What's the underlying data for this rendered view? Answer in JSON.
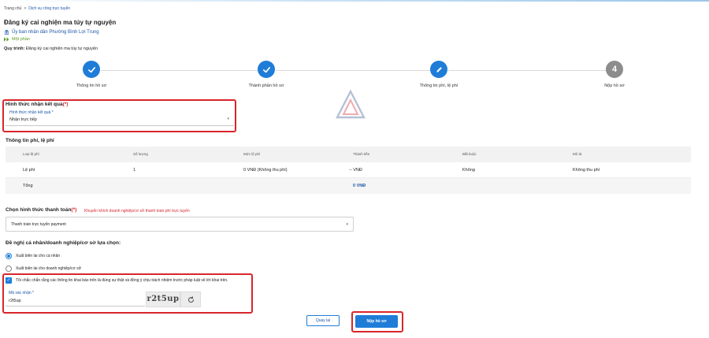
{
  "breadcrumb": {
    "home": "Trang chủ",
    "separator": ">",
    "current": "Dịch vụ công trực tuyến"
  },
  "procedure": {
    "title": "Đăng ký cai nghiện ma túy tự nguyện",
    "agency": "Ủy ban nhân dân Phường Bình Lợi Trung",
    "level": "Một phần",
    "process_label": "Quy trình:",
    "process_value": "Đăng ký cai nghiện ma túy tự nguyện"
  },
  "steps": [
    {
      "label": "Thông tin hồ sơ",
      "state": "done",
      "icon": "check-icon"
    },
    {
      "label": "Thành phần hồ sơ",
      "state": "done",
      "icon": "check-icon"
    },
    {
      "label": "Thông tin phí, lệ phí",
      "state": "active",
      "icon": "pencil-icon"
    },
    {
      "label": "Nộp hồ sơ",
      "state": "todo",
      "number": "4"
    }
  ],
  "result_section": {
    "title": "Hình thức nhận kết quả",
    "required_mark": "(*)",
    "field_label": "Hình thức nhận kết quả *",
    "field_value": "Nhận trực tiếp"
  },
  "fees": {
    "title": "Thông tin phí, lệ phí",
    "columns": [
      "Loại lệ phí",
      "Số lượng",
      "Mức lệ phí",
      "Thành tiền",
      "Bắt buộc",
      "Mô tả"
    ],
    "rows": [
      [
        "Lệ phí",
        "1",
        "0 VNĐ (Không thu phí)",
        "-- VNĐ",
        "Không",
        "Không thu phí"
      ]
    ],
    "total_label": "Tổng",
    "total_value": "0 VNĐ"
  },
  "payment": {
    "title": "Chọn hình thức thanh toán",
    "required_mark": "(*)",
    "note": "Khuyến khích doanh nghiệp/cơ sở thanh toán phí trực tuyến",
    "selected": "Thanh toán trực tuyến payment"
  },
  "receipt": {
    "title": "Đề nghị cá nhân/doanh nghiệp/cơ sở lựa chọn:",
    "options": [
      {
        "label": "Xuất biên lai cho cá nhân",
        "checked": true
      },
      {
        "label": "Xuất biên lai cho doanh nghiệp/cơ sở",
        "checked": false
      }
    ]
  },
  "confirm": {
    "text": "Tôi chắc chắn rằng các thông tin khai báo trên là đúng sự thật và đồng ý chịu trách nhiệm trước pháp luật về lời khai trên.",
    "checked": true
  },
  "captcha": {
    "label": "Mã xác nhận *",
    "value": "r2t5up",
    "image_text": "r2t5up"
  },
  "actions": {
    "back": "Quay lại",
    "submit": "Nộp hồ sơ"
  },
  "colors": {
    "primary": "#1f7dd8",
    "highlight": "#d8262b",
    "link": "#1a56a8",
    "level": "#5a9d2a"
  }
}
